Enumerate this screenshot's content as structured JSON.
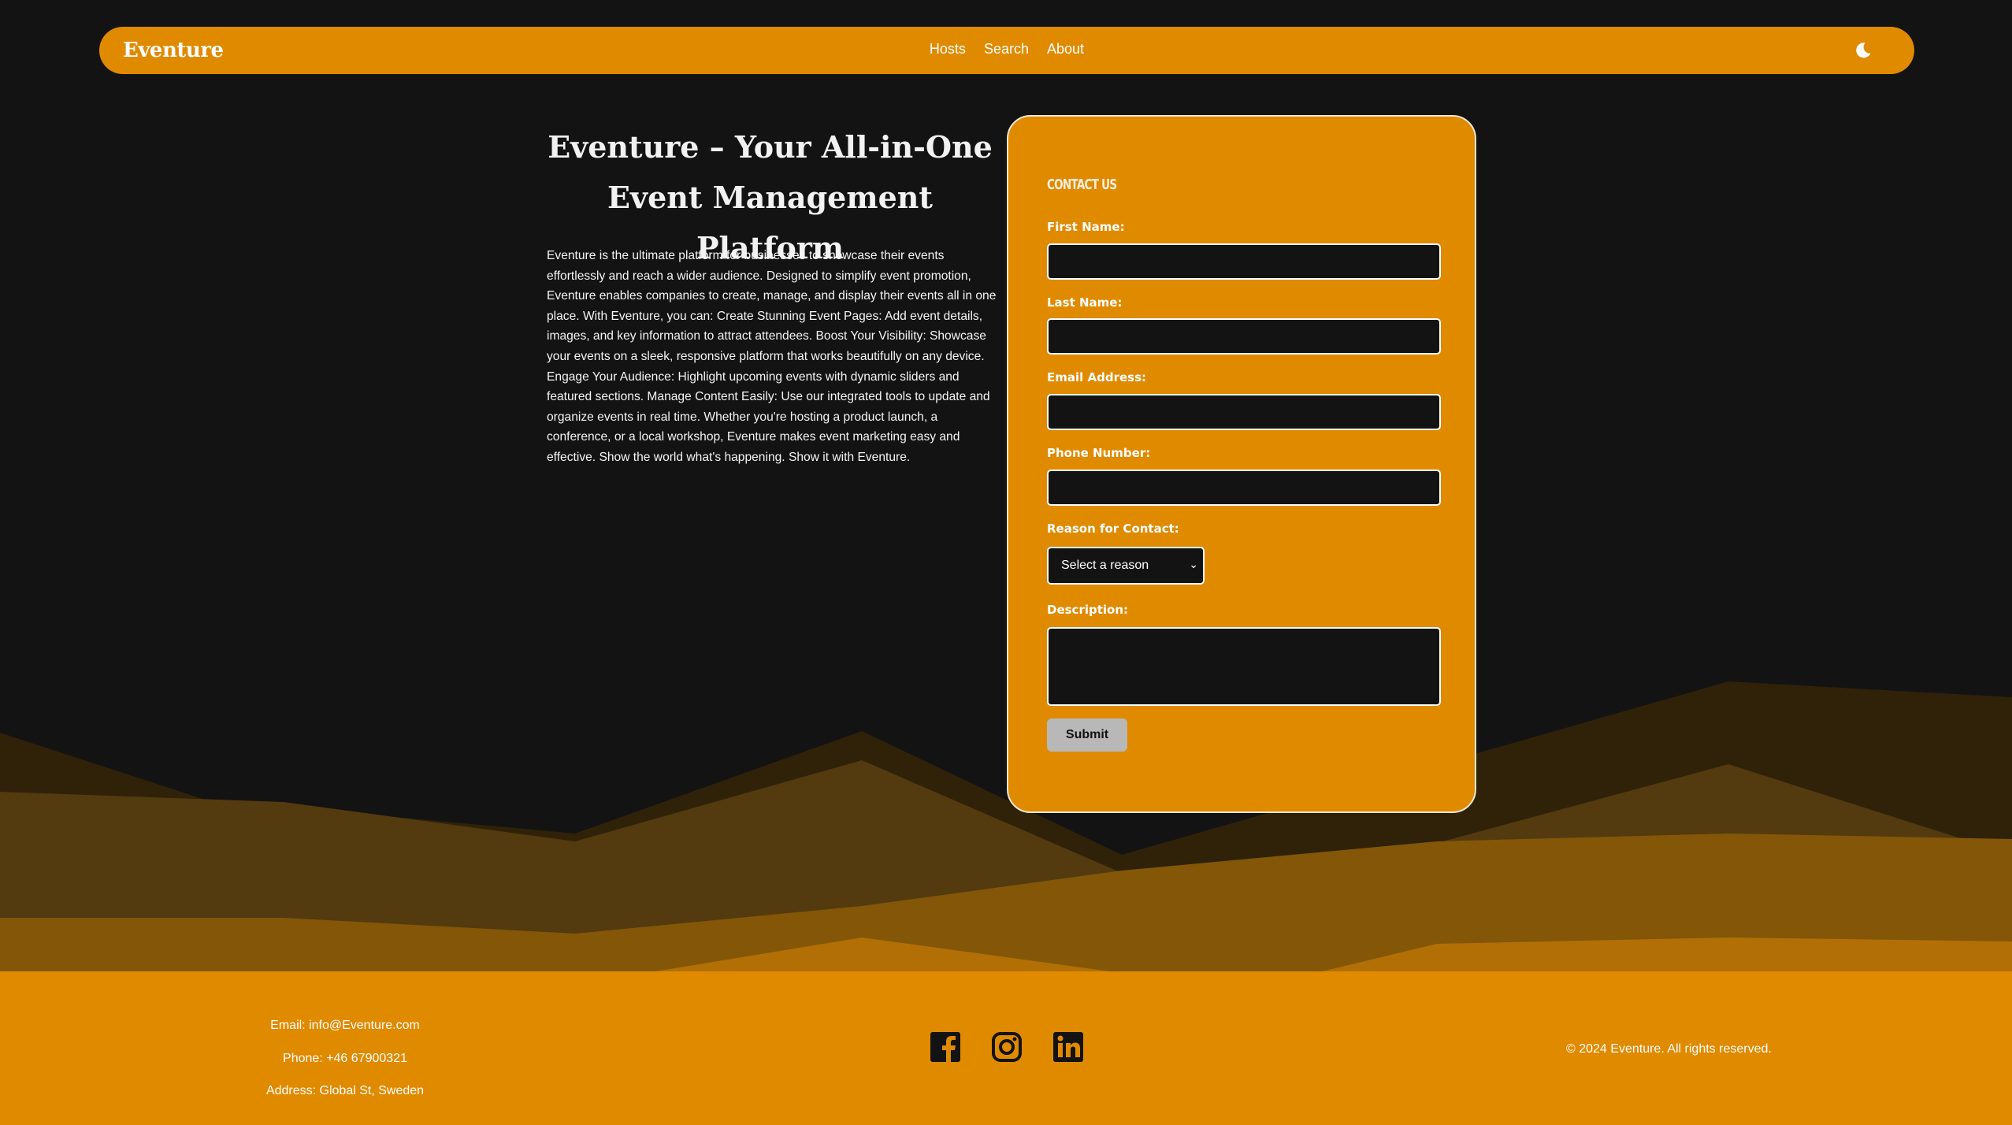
{
  "nav": {
    "brand": "Eventure",
    "links": [
      "Hosts",
      "Search",
      "About"
    ],
    "theme_toggle_icon": "moon-icon"
  },
  "hero": {
    "title_line1": "Eventure – Your All-in-One",
    "title_line2": "Event Management Platform",
    "description": "Eventure is the ultimate platform for businesses to showcase their events effortlessly and reach a wider audience. Designed to simplify event promotion, Eventure enables companies to create, manage, and display their events all in one place. With Eventure, you can: Create Stunning Event Pages: Add event details, images, and key information to attract attendees. Boost Your Visibility: Showcase your events on a sleek, responsive platform that works beautifully on any device. Engage Your Audience: Highlight upcoming events with dynamic sliders and featured sections. Manage Content Easily: Use our integrated tools to update and organize events in real time. Whether you're hosting a product launch, a conference, or a local workshop, Eventure makes event marketing easy and effective. Show the world what's happening. Show it with Eventure."
  },
  "form": {
    "title": "CONTACT US",
    "first_name_label": "First Name:",
    "first_name_value": "",
    "last_name_label": "Last Name:",
    "last_name_value": "",
    "email_label": "Email Address:",
    "email_value": "",
    "phone_label": "Phone Number:",
    "phone_value": "",
    "reason_label": "Reason for Contact:",
    "reason_selected": "Select a reason",
    "description_label": "Description:",
    "description_value": "",
    "submit_label": "Submit"
  },
  "footer": {
    "email": "Email: info@Eventure.com",
    "phone": "Phone: +46 67900321",
    "address": "Address: Global St, Sweden",
    "socials": [
      "facebook-icon",
      "instagram-icon",
      "linkedin-icon"
    ],
    "copyright": "© 2024 Eventure. All rights reserved."
  },
  "colors": {
    "background": "#131313",
    "accent": "#e08a00",
    "field_bg": "#131313",
    "submit_bg": "#b8b8b8"
  }
}
